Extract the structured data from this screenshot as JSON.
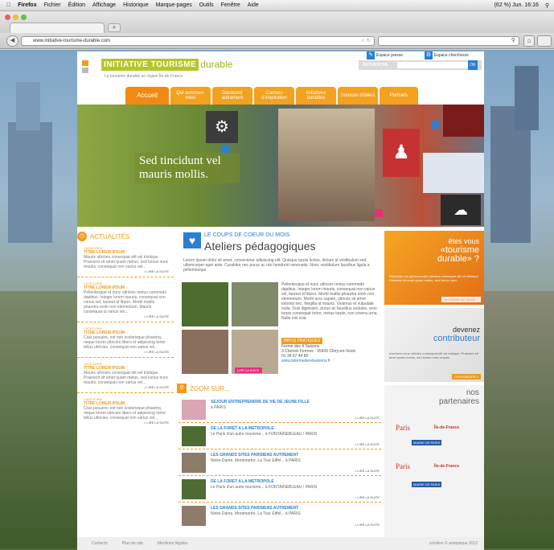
{
  "menubar": {
    "app": "Firefox",
    "items": [
      "Fichier",
      "Édition",
      "Affichage",
      "Historique",
      "Marque-pages",
      "Outils",
      "Fenêtre",
      "Aide"
    ],
    "status": "(62 %) Jun. 16:16"
  },
  "browser": {
    "url": "www.initiative-tourisme-durable.com",
    "new_tab": "+"
  },
  "site": {
    "logo_part1": "INITIATIVE",
    "logo_part2": "TOURISME",
    "logo_part3": "durable",
    "tagline": "Le tourisme durable en région Île-de-France",
    "espace_presse": "Espace presse",
    "espace_chercheurs": "Espace chercheurs",
    "search_label": "RECHERCHE",
    "search_ok": "OK",
    "nav": [
      "Accueil",
      "Qui sommes-nous",
      "Découvrir autrement",
      "Carnets d'inspiration",
      "Initiatives durables",
      "Sources d'idées",
      "Portraits"
    ],
    "banner_text": "Sed tincidunt vel mauris mollis."
  },
  "actualites": {
    "title": "ACTUALITÉS",
    "items": [
      {
        "cat": "CATEGORIE",
        "title": "TITRE LOREM IPSUM",
        "body": "Mauris ultricies consequat elit vel tristique. Praesent sit amet quam metus, sed luctus nunc mauris, consequat non varius vel...",
        "more": "> LIRE LA SUITE"
      },
      {
        "cat": "CATEGORIE",
        "title": "TITRE LOREM IPSUM",
        "body": "Pellentesque id nunc ultricies metus commodo dapibus. Integer lorem mauris, consequat non varius vel, laoreet id libero. Morbi mattis pharetra enim non elementum. Mauris consequat ut varius vel...",
        "more": "> LIRE LA SUITE"
      },
      {
        "cat": "CATEGORIE",
        "title": "TITRE LOREM IPSUM",
        "body": "Cras posuere, est non scelerisque pharetra, neque lorem ultricies libero et adipiscing tortor tellus ultricies, consequat non varius vel...",
        "more": "> LIRE LA SUITE"
      },
      {
        "cat": "CATEGORIE",
        "title": "TITRE LOREM IPSUM",
        "body": "Mauris ultricies consequat elit vel tristique. Praesent sit amet quam metus, sed luctus nunc mauris, consequat non varius vel...",
        "more": "> LIRE LA SUITE"
      },
      {
        "cat": "CATEGORIE",
        "title": "TITRE LOREM IPSUM",
        "body": "Cras posuere, est non scelerisque pharetra, neque lorem ultricies libero et adipiscing tortor tellus ultricies, consequat non varius vel...",
        "more": "> LIRE LA SUITE"
      }
    ]
  },
  "coup_de_coeur": {
    "label": "LE COUPS DE COEUR DU MOIS",
    "title": "Ateliers pédagogiques",
    "intro": "Lorem ipsum dolor sit amet, consectetur adipiscing elit. Quisque turpis lectus, dictum id vestibulum sed, ullamcorper eget ante. Curabitur nec purus ac nisi hendrerit venenatis. Nunc vestibulum faucibus ligula a pellentesque.",
    "desc": "Pellentesque id nunc ultricies metus commodo dapibus. Integer lorem mauris, consequat non varius vel, laoreet id libero. Morbi mattis pharetra enim non elementum. Morbi arcu sapien, ultrices sit amet lobortis nec, fringilla id mauris. Vivamus et vulputate nulla. Duis dignissim, purus ac faucibus sodales, eros turpis consequat tortor, metus turpis, non viverra urna. Nulla nisi erat.",
    "info_badge": "INFOS PRATIQUES",
    "info": [
      "Ferme des 4 Saisons",
      "3 Chemin Fermes - 95420 Cléry-en-Vexin",
      "01 34 67 44 80",
      "www.lafermedes4saisons.fr"
    ],
    "more": "LIRE LA SUITE"
  },
  "zoom": {
    "title": "ZOOM SUR...",
    "items": [
      {
        "title": "SEJOUR ENTREPRENDRE DE VIE DE JEUNE FILLE",
        "sub": "à PARIS",
        "more": "> LIRE LA SUITE"
      },
      {
        "title": "DE LA FORET A LA METROPOLE",
        "sub": "Le Paris d'un autre tourisme... à FONTAINEBLEAU / PARIS",
        "more": "> LIRE LA SUITE"
      },
      {
        "title": "LES GRANDS SITES PARISIENS AUTREMENT",
        "sub": "Notre-Dame, Montmartre, La Tour Eiffel... à PARIS",
        "more": "> LIRE LA SUITE"
      },
      {
        "title": "DE LA FORET A LA METROPOLE",
        "sub": "Le Paris d'un autre tourisme... à FONTAINEBLEAU / PARIS",
        "more": "> LIRE LA SUITE"
      },
      {
        "title": "LES GRANDS SITES PARISIENS AUTREMENT",
        "sub": "Notre-Dame, Montmartre, La Tour Eiffel... à PARIS",
        "more": "> LIRE LA SUITE"
      }
    ]
  },
  "promos": {
    "p1_line1": "êtes vous",
    "p1_line2": "«tourisme",
    "p1_line3": "durable» ?",
    "p1_body": "Répondez au questionnaire ultricies consequat elit vel tristique. Praesent sit amet quam metus, sed luctus nunc.",
    "p1_btn": "ACCEDER AU QUIZZ >",
    "p2_line1": "devenez",
    "p2_line2": "contributeur",
    "p2_body": "Inscrivez-vous ultricies consequat elit vel tristique. Praesent sit amet quam metus, sed luctus nunc mauris.",
    "p2_btn": "CONTRIBUER >"
  },
  "partners": {
    "line1": "nos",
    "line2": "partenaires",
    "logos": [
      "Paris",
      "Île-de-France",
      "MAIRIE DE PARIS",
      "Paris",
      "Île-de-France",
      "MAIRIE DE PARIS"
    ]
  },
  "footer": {
    "links": [
      "Contacts",
      "Plan du site",
      "Mentions légales"
    ],
    "credit": "création © andopique 2012"
  },
  "colors": {
    "orange": "#f29a1f",
    "green": "#b5c628",
    "blue": "#2a7fd1"
  }
}
